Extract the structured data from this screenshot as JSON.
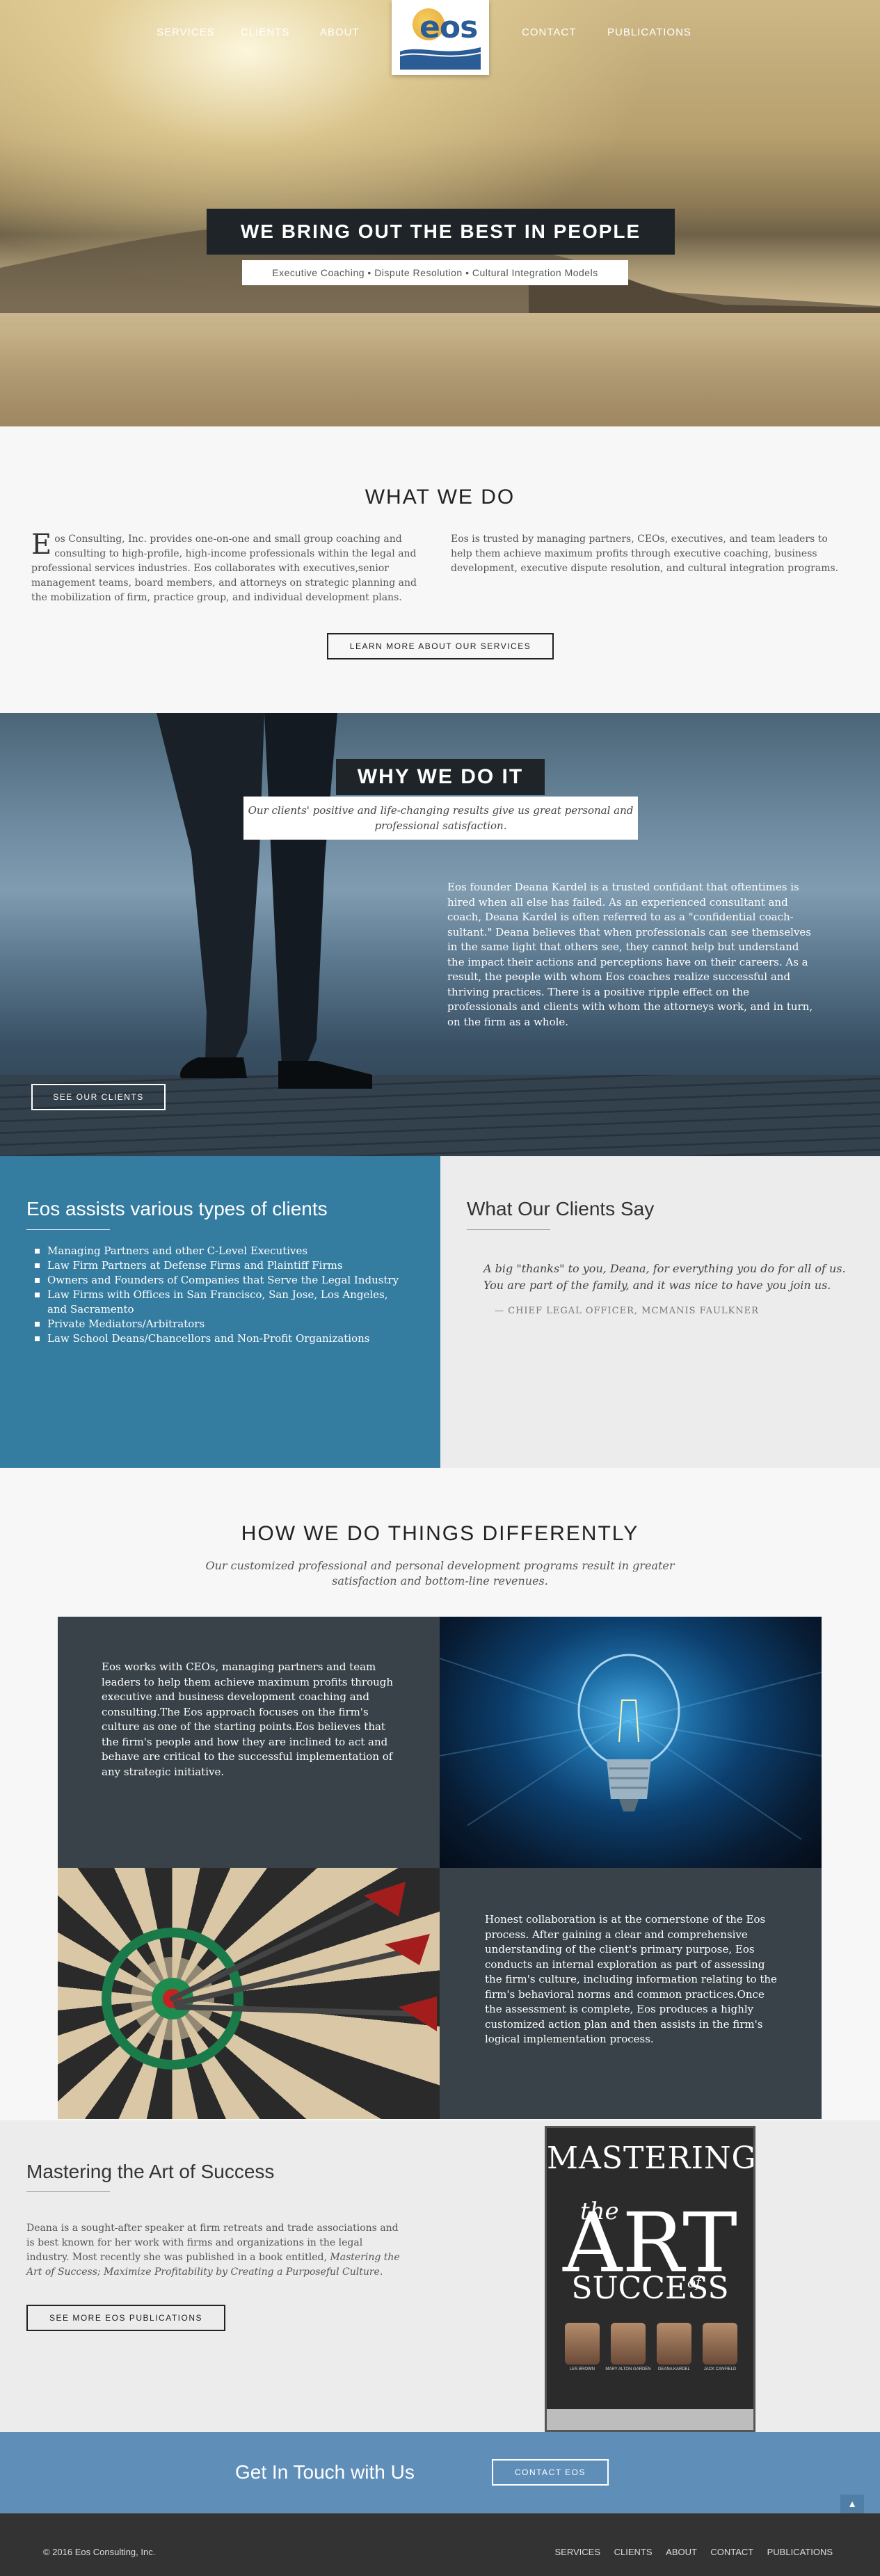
{
  "nav": {
    "items": [
      "SERVICES",
      "CLIENTS",
      "ABOUT",
      "CONTACT",
      "PUBLICATIONS"
    ],
    "logo_text": "eos"
  },
  "hero": {
    "headline": "WE BRING OUT THE BEST IN PEOPLE",
    "subline": "Executive Coaching  •  Dispute Resolution  •  Cultural Integration Models"
  },
  "what_we_do": {
    "title": "WHAT WE DO",
    "col1_drop": "E",
    "col1": "os Consulting, Inc. provides one-on-one and small group coaching and consulting to high-profile, high-income professionals within the legal and professional services industries. Eos collaborates with executives,senior management teams, board members, and attorneys on strategic planning and the mobilization of firm, practice group, and individual development plans.",
    "col2": "Eos is trusted by managing partners, CEOs, executives, and team leaders to help them achieve maximum profits through executive coaching, business development, executive dispute resolution, and cultural integration programs.",
    "button": "LEARN MORE ABOUT OUR SERVICES"
  },
  "why_we_do": {
    "title": "WHY WE DO IT",
    "subtitle": "Our clients' positive and life-changing results give us great personal and professional satisfaction.",
    "body": "Eos founder Deana Kardel is a trusted confidant that oftentimes is hired when all else has failed. As an experienced consultant and coach, Deana Kardel is often referred to as a \"confidential coach-sultant.\" Deana believes that when professionals can see themselves in the same light that others see, they cannot help but understand the impact their actions and perceptions have on their careers. As a result, the people with whom Eos coaches realize successful and thriving practices. There is a positive ripple effect on the professionals and clients with whom the attorneys work, and in turn, on the firm as a whole.",
    "button": "SEE OUR CLIENTS"
  },
  "clients": {
    "title": "Eos assists various types of clients",
    "items": [
      "Managing Partners and other C-Level Executives",
      "Law Firm Partners at Defense Firms and Plaintiff Firms",
      "Owners and Founders of Companies that Serve the Legal Industry",
      "Law Firms with Offices in San Francisco, San Jose, Los Angeles, and Sacramento",
      "Private Mediators/Arbitrators",
      "Law School Deans/Chancellors and Non-Profit Organizations"
    ]
  },
  "testimonial": {
    "title": "What Our Clients Say",
    "quote": "A big \"thanks\" to you, Deana, for everything you do for all of us. You are part of the family, and it was nice to have you join us.",
    "attribution": "— CHIEF LEGAL OFFICER, MCMANIS FAULKNER"
  },
  "how_we_do": {
    "title": "HOW WE DO THINGS DIFFERENTLY",
    "subtitle": "Our customized professional and personal development programs result in greater satisfaction and bottom-line revenues.",
    "tile1": "Eos works with CEOs, managing partners and team leaders to help them achieve maximum profits through executive and business development coaching and consulting.The Eos approach focuses on the firm's culture as one of the starting points.Eos believes that the firm's people and how they are inclined to act and behave are critical to the successful implementation of any strategic initiative.",
    "tile2": "Honest collaboration is at the cornerstone of the Eos process. After gaining a clear and comprehensive understanding of the client's primary purpose, Eos conducts an internal exploration as part of assessing the firm's culture, including information relating to the firm's behavioral norms and common practices.Once the assessment is complete, Eos produces a highly customized action plan and then assists in the firm's logical implementation process."
  },
  "mastering": {
    "title": "Mastering the Art of Success",
    "text_before": "Deana is a sought-after speaker at firm retreats and trade associations and is best known for her work with firms and organizations in the legal industry. Most recently she was published in a book entitled, ",
    "text_italic": "Mastering the Art of Success; Maximize Profitability by Creating a Purposeful Culture.",
    "button": "SEE MORE EOS PUBLICATIONS",
    "book": {
      "line1": "MASTERING",
      "line2": "the",
      "line3": "ART",
      "line4": "SUCCESS",
      "line5": "of",
      "authors": [
        "LES BROWN",
        "MARY ALTON GARDEN",
        "DEANA KARDEL",
        "JACK CANFIELD"
      ]
    }
  },
  "contact": {
    "title": "Get In Touch with Us",
    "button": "CONTACT EOS"
  },
  "footer": {
    "copyright": "© 2016 Eos Consulting, Inc.",
    "links": [
      "SERVICES",
      "CLIENTS",
      "ABOUT",
      "CONTACT",
      "PUBLICATIONS"
    ]
  }
}
